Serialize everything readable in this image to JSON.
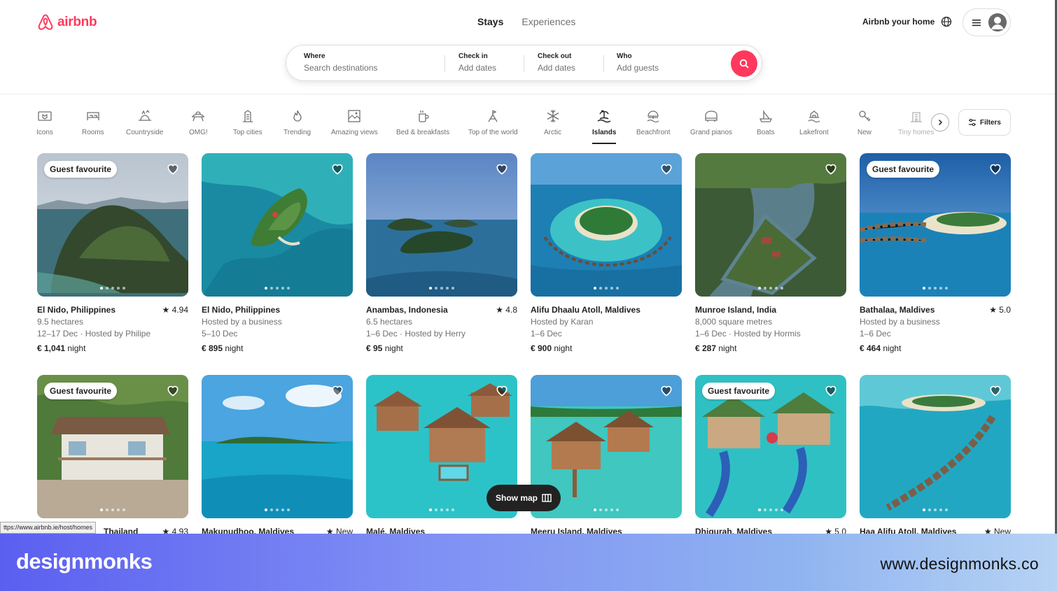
{
  "header": {
    "logo_text": "airbnb",
    "tabs": [
      "Stays",
      "Experiences"
    ],
    "host_link": "Airbnb your home"
  },
  "search": {
    "where_label": "Where",
    "where_value": "Search destinations",
    "checkin_label": "Check in",
    "checkin_value": "Add dates",
    "checkout_label": "Check out",
    "checkout_value": "Add dates",
    "who_label": "Who",
    "who_value": "Add guests"
  },
  "categories": [
    "Icons",
    "Rooms",
    "Countryside",
    "OMG!",
    "Top cities",
    "Trending",
    "Amazing views",
    "Bed & breakfasts",
    "Top of the world",
    "Arctic",
    "Islands",
    "Beachfront",
    "Grand pianos",
    "Boats",
    "Lakefront",
    "New",
    "Tiny homes"
  ],
  "active_category": "Islands",
  "filters_label": "Filters",
  "listings": [
    {
      "title": "El Nido, Philippines",
      "rating": "★ 4.94",
      "line1": "9.5 hectares",
      "line2": "12–17 Dec · Hosted by Philipe",
      "price": "€ 1,041",
      "unit": "night",
      "badge": "Guest favourite"
    },
    {
      "title": "El Nido, Philippines",
      "rating": "",
      "line1": "Hosted by a business",
      "line2": "5–10 Dec",
      "price": "€ 895",
      "unit": "night",
      "badge": ""
    },
    {
      "title": "Anambas, Indonesia",
      "rating": "★ 4.8",
      "line1": "6.5 hectares",
      "line2": "1–6 Dec · Hosted by Herry",
      "price": "€ 95",
      "unit": "night",
      "badge": ""
    },
    {
      "title": "Alifu Dhaalu Atoll, Maldives",
      "rating": "",
      "line1": "Hosted by Karan",
      "line2": "1–6 Dec",
      "price": "€ 900",
      "unit": "night",
      "badge": ""
    },
    {
      "title": "Munroe Island, India",
      "rating": "",
      "line1": "8,000 square metres",
      "line2": "1–6 Dec · Hosted by Hormis",
      "price": "€ 287",
      "unit": "night",
      "badge": ""
    },
    {
      "title": "Bathalaa, Maldives",
      "rating": "★ 5.0",
      "line1": "Hosted by a business",
      "line2": "1–6 Dec",
      "price": "€ 464",
      "unit": "night",
      "badge": "Guest favourite"
    },
    {
      "title": "Thailand",
      "rating": "★ 4.93",
      "badge": "Guest favourite"
    },
    {
      "title": "Makunudhoo, Maldives",
      "rating": "★ New",
      "badge": ""
    },
    {
      "title": "Malé, Maldives",
      "rating": "",
      "badge": ""
    },
    {
      "title": "Meeru Island, Maldives",
      "rating": "",
      "badge": ""
    },
    {
      "title": "Dhigurah, Maldives",
      "rating": "★ 5.0",
      "badge": "Guest favourite"
    },
    {
      "title": "Haa Alifu Atoll, Maldives",
      "rating": "★ New",
      "badge": ""
    }
  ],
  "show_map_label": "Show map",
  "status_url": "ttps://www.airbnb.ie/host/homes",
  "footer": {
    "brand": "designmonks",
    "website": "www.designmonks.co"
  },
  "colors": {
    "brand": "#ff385c",
    "banner_start": "#5b5ff0",
    "banner_end": "#b6d3f4"
  }
}
